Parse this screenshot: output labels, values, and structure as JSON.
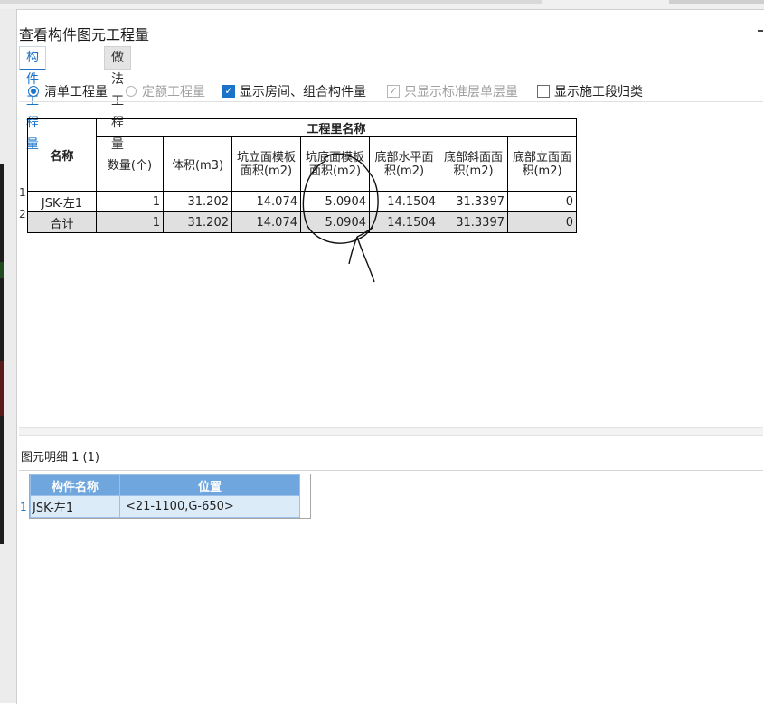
{
  "dialog": {
    "title": "查看构件图元工程量",
    "tabs": [
      {
        "label": "构件工程量",
        "active": true
      },
      {
        "label": "做法工程量",
        "active": false
      }
    ]
  },
  "options": {
    "radio_bill": "清单工程量",
    "radio_quota": "定额工程量",
    "check_room": "显示房间、组合构件量",
    "check_std_floor": "只显示标准层单层量",
    "check_section": "显示施工段归类"
  },
  "table": {
    "name_header": "名称",
    "group_header": "工程里名称",
    "columns": [
      "数量(个)",
      "体积(m3)",
      "坑立面模板面积(m2)",
      "坑底面模板面积(m2)",
      "底部水平面积(m2)",
      "底部斜面面积(m2)",
      "底部立面面积(m2)"
    ],
    "rows": [
      {
        "index": "1",
        "name": "JSK-左1",
        "values": [
          "1",
          "31.202",
          "14.074",
          "5.0904",
          "14.1504",
          "31.3397",
          "0"
        ]
      },
      {
        "index": "2",
        "name": "合计",
        "values": [
          "1",
          "31.202",
          "14.074",
          "5.0904",
          "14.1504",
          "31.3397",
          "0"
        ]
      }
    ]
  },
  "detail": {
    "title": "图元明细  1 (1)",
    "headers": [
      "构件名称",
      "位置"
    ],
    "rows": [
      {
        "index": "1",
        "name": "JSK-左1",
        "position": "<21-1100,G-650>"
      }
    ]
  },
  "colors": {
    "accent": "#1a73c9",
    "detail_header": "#6ea6dd",
    "detail_row": "#dcebf8",
    "total_row": "#e0e0e0"
  }
}
